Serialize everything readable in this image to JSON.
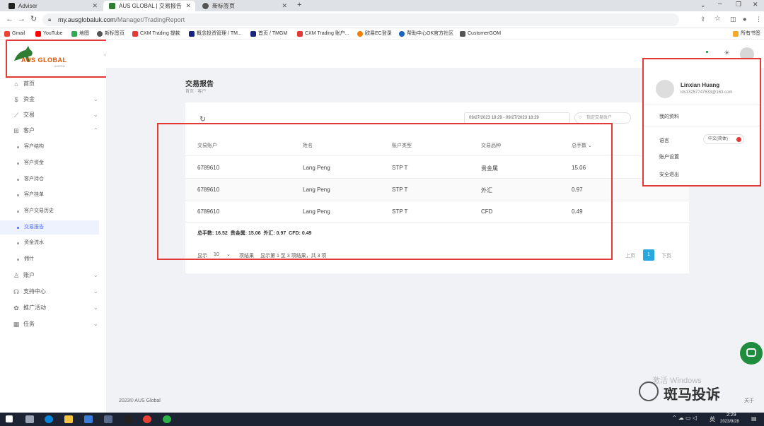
{
  "browser": {
    "tabs": [
      {
        "label": "Adviser",
        "color": "#222222"
      },
      {
        "label": "AUS GLOBAL | 交易报告",
        "color": "#2e7d32"
      },
      {
        "label": "新标签页",
        "color": "#555555"
      }
    ],
    "new_tab": "+",
    "url_domain": "my.ausglobaluk.com",
    "url_path": "/Manager/TradingReport",
    "bookmarks": [
      {
        "label": "Gmail",
        "color": "#ea4335"
      },
      {
        "label": "YouTube",
        "color": "#ff0000"
      },
      {
        "label": "地图",
        "color": "#34a853"
      },
      {
        "label": "新标签页",
        "color": "#555555"
      },
      {
        "label": "CXM Trading 提款",
        "color": "#e53935"
      },
      {
        "label": "概念投资管理 / TM...",
        "color": "#1a237e"
      },
      {
        "label": "首页 / TMGM",
        "color": "#1a237e"
      },
      {
        "label": "CXM Trading 账户...",
        "color": "#e53935"
      },
      {
        "label": "欧易EC登录",
        "color": "#f57c00"
      },
      {
        "label": "帮助中心OK官方社区",
        "color": "#1565c0"
      },
      {
        "label": "CustomerGOM",
        "color": "#555555"
      }
    ],
    "bookmarks_all": "所有书签"
  },
  "brand": {
    "logo_text": "AUS GLOBAL",
    "logo_sub": "LIMITED",
    "copyright": "2023© AUS Global"
  },
  "sidebar": {
    "items": [
      {
        "label": "首页",
        "icon": "home-icon"
      },
      {
        "label": "资金",
        "icon": "dollar-icon"
      },
      {
        "label": "交易",
        "icon": "chart-icon"
      },
      {
        "label": "客户",
        "icon": "users-icon"
      }
    ],
    "sub_items": [
      "客户结构",
      "客户资金",
      "客户持仓",
      "客户挂单",
      "客户交易历史",
      "交易报告",
      "资金流水",
      "佣什"
    ],
    "items_bottom": [
      {
        "label": "账户",
        "icon": "user-icon"
      },
      {
        "label": "支持中心",
        "icon": "headset-icon"
      },
      {
        "label": "推广活动",
        "icon": "gift-icon"
      },
      {
        "label": "任务",
        "icon": "calendar-icon"
      }
    ]
  },
  "page": {
    "title": "交易报告",
    "breadcrumb": "首页 · 客户"
  },
  "filters": {
    "date_range": "09/27/2023 18:29 - 09/27/2023 18:29",
    "account_placeholder": "指定交易账户"
  },
  "table": {
    "headers": [
      "交易账户",
      "姓名",
      "账户类型",
      "交易品种",
      "总手数"
    ],
    "rows": [
      [
        "6789610",
        "Lang Peng",
        "STP T",
        "贵金属",
        "15.06"
      ],
      [
        "6789610",
        "Lang Peng",
        "STP T",
        "外汇",
        "0.97"
      ],
      [
        "6789610",
        "Lang Peng",
        "STP T",
        "CFD",
        "0.49"
      ]
    ],
    "summary": "总手数: 16.52  贵金属: 15.06  外汇: 0.97  CFD: 0.49"
  },
  "pagination": {
    "show_label": "显示",
    "page_size": "10",
    "per_page_suffix": "项结果",
    "info": "显示第 1 至 3 项结果，共 3 项",
    "prev": "上页",
    "current": "1",
    "next": "下页"
  },
  "profile": {
    "name": "Linxian Huang",
    "email": "lds13257747633@163.com",
    "my_info": "我的资料",
    "language_label": "语言",
    "language_value": "中文(简体)",
    "account_settings": "账户设置",
    "logout": "安全退出"
  },
  "watermarks": {
    "windows": "激活 Windows",
    "brand": "斑马投诉",
    "side": "关于"
  },
  "taskbar": {
    "time": "2:29",
    "date": "2023/9/28",
    "ime": "英"
  },
  "colors": {
    "accent": "#4a6cf7",
    "red_highlight": "#e53935",
    "chat": "#1e8e3e"
  }
}
